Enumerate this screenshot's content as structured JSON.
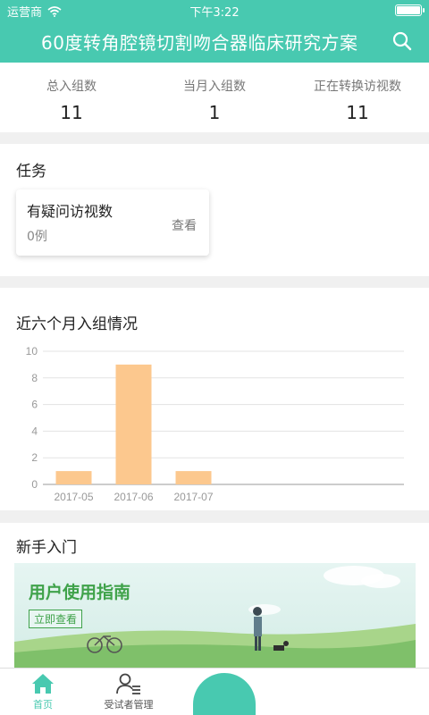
{
  "status_bar": {
    "carrier": "运营商",
    "time": "下午3:22"
  },
  "header": {
    "title": "60度转角腔镜切割吻合器临床研究方案"
  },
  "stats": [
    {
      "label": "总入组数",
      "value": "11"
    },
    {
      "label": "当月入组数",
      "value": "1"
    },
    {
      "label": "正在转换访视数",
      "value": "11"
    }
  ],
  "tasks": {
    "title": "任务",
    "card": {
      "name": "有疑问访视数",
      "count": "0例",
      "link": "查看"
    }
  },
  "enrollment": {
    "title": "近六个月入组情况"
  },
  "chart_data": {
    "type": "bar",
    "categories": [
      "2017-05",
      "2017-06",
      "2017-07"
    ],
    "values": [
      1,
      9,
      1
    ],
    "ylim": [
      0,
      10
    ],
    "yticks": [
      0,
      2,
      4,
      6,
      8,
      10
    ],
    "grid": true,
    "bar_color": "#fcc88e"
  },
  "guide": {
    "title": "新手入门",
    "banner_title": "用户使用指南",
    "banner_button": "立即查看"
  },
  "tabbar": {
    "home": "首页",
    "subjects": "受试者管理"
  },
  "colors": {
    "accent": "#48c9b0",
    "guide_green": "#3fa24a"
  }
}
